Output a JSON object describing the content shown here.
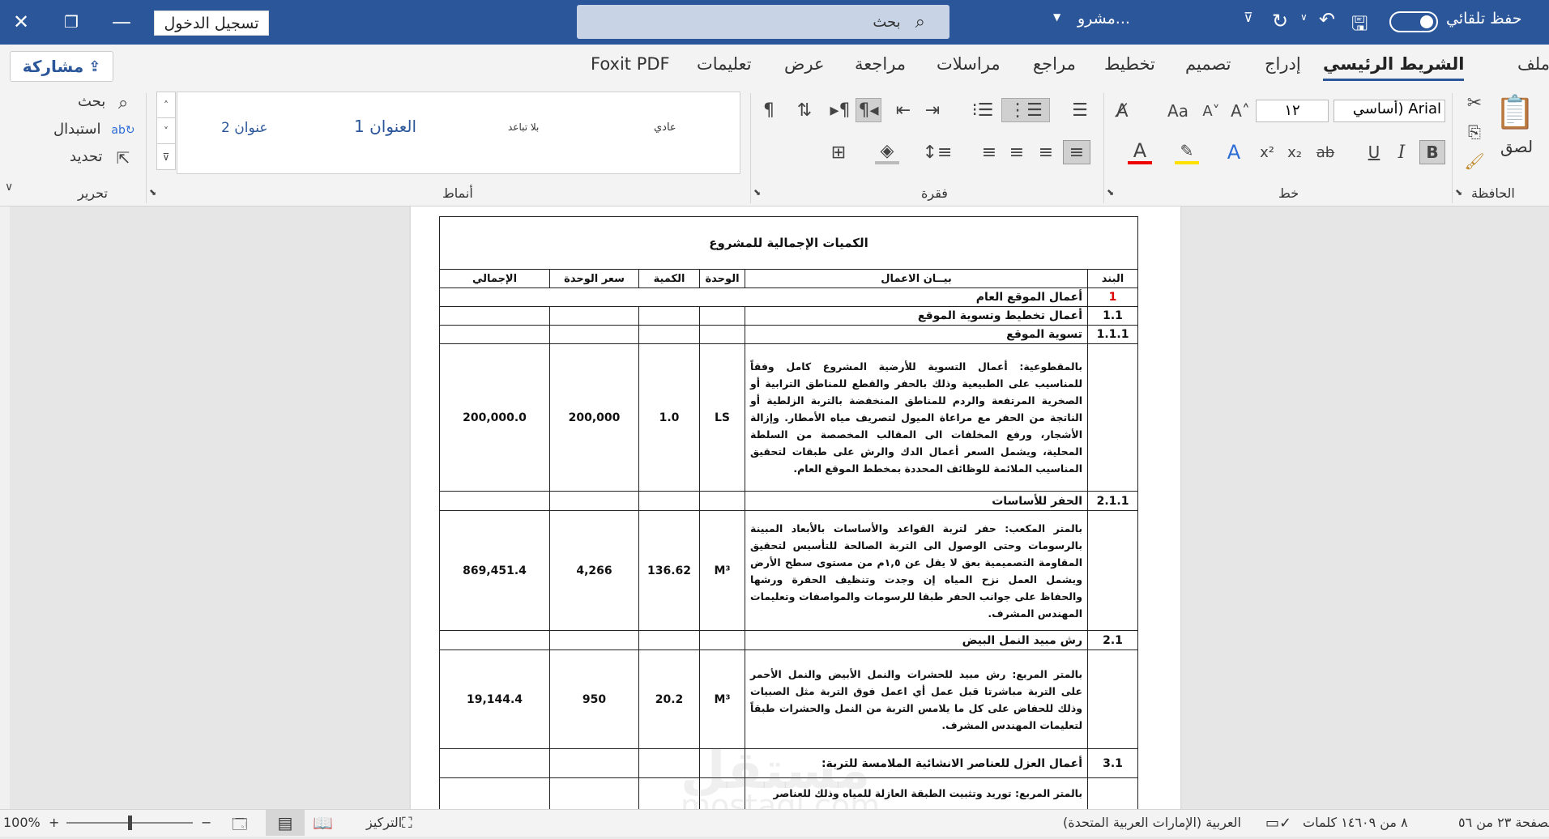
{
  "titlebar": {
    "autosave_label": "حفظ تلقائي",
    "doc_name": "مشرو...",
    "search_placeholder": "بحث",
    "signin_label": "تسجيل الدخول"
  },
  "tabs": [
    "ملف",
    "الشريط الرئيسي",
    "إدراج",
    "تصميم",
    "تخطيط",
    "مراجع",
    "مراسلات",
    "مراجعة",
    "عرض",
    "تعليمات",
    "Foxit PDF"
  ],
  "share_label": "مشاركة",
  "ribbon": {
    "clipboard": {
      "paste": "لصق",
      "group": "الحافظة"
    },
    "font": {
      "name": "Arial (أساسي",
      "size": "١٢",
      "group": "خط",
      "bold": "B",
      "italic": "I",
      "underline": "U",
      "strike": "ab",
      "sub": "x₂",
      "sup": "x²",
      "aa": "Aa"
    },
    "paragraph": {
      "group": "فقرة"
    },
    "styles": {
      "normal": "عادي",
      "nospacing": "بلا تباعد",
      "heading1": "العنوان 1",
      "heading2": "عنوان 2",
      "group": "أنماط"
    },
    "editing": {
      "find": "بحث",
      "replace": "استبدال",
      "select": "تحديد",
      "group": "تحرير"
    }
  },
  "document": {
    "title": "الكميات الإجمالية للمشروع",
    "headers": {
      "item": "البند",
      "desc": "بيــان الاعمال",
      "unit": "الوحدة",
      "qty": "الكمية",
      "price": "سعر الوحدة",
      "total": "الإجمالي"
    },
    "rows": {
      "r1": {
        "item": "1",
        "desc": "أعمال الموقع العام"
      },
      "r2": {
        "item": "1.1",
        "desc": "أعمال تخطيط وتسوية الموقع"
      },
      "r3": {
        "item": "1.1.1",
        "desc": "تسوية الموقع"
      },
      "r4": {
        "desc": "بالمقطوعية: أعمال التسوية للأرضية المشروع كامل وفقاً للمناسيب على الطبيعية وذلك بالحفر والقطع للمناطق الترابية أو الصخرية المرتفعة والردم للمناطق المنخفضة بالتربة الزلطية أو الناتجة من الحفر مع مراعاة الميول لتصريف مياه الأمطار. وإزالة الأشجار، ورفع المخلفات الى المقالب المخصصة من السلطة المحلية، ويشمل السعر أعمال الدك والرش على طبقات لتحقيق المناسيب الملائمة للوظائف المحددة بمخطط الموقع العام.",
        "unit": "LS",
        "qty": "1.0",
        "price": "200,000",
        "total": "200,000.0"
      },
      "r5": {
        "item": "2.1.1",
        "desc": "الحفر للأساسات"
      },
      "r6": {
        "desc": "بالمتر المكعب: حفر لتربة القواعد والأساسات بالأبعاد المبينة بالرسومات وحتى الوصول الى التربة الصالحة للتأسيس لتحقيق المقاومة التصميمية بعق لا يقل عن ١,٥م من مستوى سطح الأرض ويشمل العمل نزح المياه إن وجدت وتنظيف الحفرة ورشها والحفاظ على جوانب الحفر طبقا للرسومات والمواصفات وتعليمات المهندس المشرف.",
        "unit": "M³",
        "qty": "136.62",
        "price": "4,266",
        "total": "869,451.4"
      },
      "r7": {
        "item": "2.1",
        "desc": "رش مبيد النمل البيض"
      },
      "r8": {
        "desc": "بالمتر المربع: رش مبيد للحشرات والنمل الأبيض والنمل الأحمر على التربة مباشرتا قبل عمل أي اعمل فوق التربة مثل الصبيات وذلك للحفاض على كل ما يلامس التربة من النمل والحشرات طبقاً لتعليمات المهندس المشرف.",
        "unit": "M³",
        "qty": "20.2",
        "price": "950",
        "total": "19,144.4"
      },
      "r9": {
        "item": "3.1",
        "desc": "أعمال العزل للعناصر الانشائية الملامسة للتربة:"
      },
      "r10": {
        "desc": "بالمتر المربع: توريد وتثبيت الطبقة العازلة للمياه وذلك للعناصر"
      }
    }
  },
  "statusbar": {
    "page": "الصفحة ٢٣ من ٥٦",
    "words": "٨ من ١٤٦٠٩ كلمات",
    "lang": "العربية (الإمارات العربية المتحدة)",
    "focus": "التركيز",
    "zoom": "100%"
  },
  "watermark": {
    "ar": "مستقل",
    "en": "mostaql.com"
  }
}
